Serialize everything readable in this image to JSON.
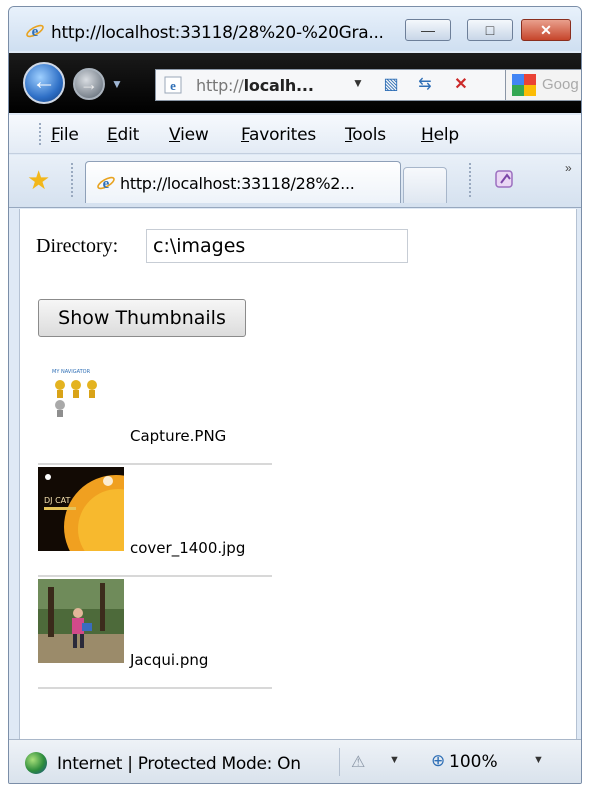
{
  "window": {
    "title": "http://localhost:33118/28%20-%20Gra...",
    "controls": {
      "minimize": "—",
      "maximize": "□",
      "close": "✕"
    }
  },
  "navbar": {
    "back_glyph": "←",
    "forward_glyph": "→",
    "dropdown_glyph": "▼",
    "address_prefix": "http://",
    "address_host": "localh...",
    "address_dropdown": "▼",
    "compat_glyph": "▧",
    "refresh_glyph": "⇆",
    "stop_glyph": "✕",
    "search_placeholder": "Goog"
  },
  "menu": {
    "items": [
      "File",
      "Edit",
      "View",
      "Favorites",
      "Tools",
      "Help"
    ]
  },
  "tabs": {
    "favorites_glyph": "★",
    "active_tab": "http://localhost:33118/28%2...",
    "more_glyph": "»"
  },
  "page": {
    "directory_label": "Directory:",
    "directory_value": "c:\\images",
    "show_button_label": "Show Thumbnails",
    "thumbnails": [
      {
        "name": "Capture.PNG",
        "image_caption": "MY NAVIGATOR"
      },
      {
        "name": "cover_1400.jpg",
        "image_caption": "DJ CAT"
      },
      {
        "name": "Jacqui.png"
      }
    ]
  },
  "status": {
    "zone_text": "Internet | Protected Mode: On",
    "security_glyph": "⚠",
    "dropdown_glyph": "▼",
    "zoom_glyph": "⊕",
    "zoom_level": "100%"
  },
  "colors": {
    "ie_blue": "#2f6fb6",
    "close_red": "#c6452b",
    "navbar_black": "#000000",
    "star_gold": "#f2b71b"
  },
  "icons": {
    "title": "ie-logo-icon",
    "back": "back-arrow-icon",
    "forward": "forward-arrow-icon",
    "favorites": "favorites-star-icon",
    "zone": "internet-globe-icon",
    "zoom": "zoom-icon"
  }
}
